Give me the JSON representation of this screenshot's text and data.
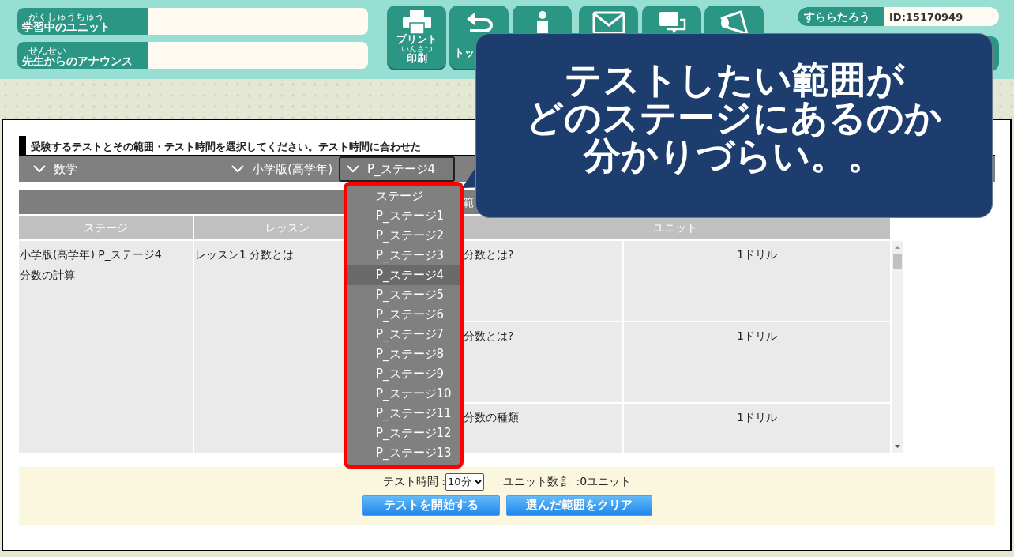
{
  "header": {
    "fields": [
      {
        "ruby_base": "学習中",
        "ruby": "がくしゅうちゅう",
        "rest": "のユニット"
      },
      {
        "ruby_base": "先生",
        "ruby": "せんせい",
        "rest": "からのアナウンス"
      }
    ],
    "toolbar": [
      {
        "kind": "print",
        "label": "プリント",
        "ruby_base": "印刷",
        "ruby": "いんさつ"
      },
      {
        "kind": "back",
        "label": "トッ"
      },
      {
        "kind": "person"
      },
      {
        "kind": "mail"
      },
      {
        "kind": "help"
      },
      {
        "kind": "megaphone"
      }
    ],
    "user": {
      "name": "すららたろう",
      "id": "ID:15170949"
    }
  },
  "instruction": "受験するテストとその範囲・テスト時間を選択してください。テスト時間に合わせた",
  "selects": [
    {
      "value": "数学",
      "focused": false
    },
    {
      "value": "小学版(高学年)",
      "focused": false
    },
    {
      "value": "P_ステージ4",
      "focused": true
    }
  ],
  "table": {
    "range_header": "範",
    "columns": [
      "ステージ",
      "レッスン",
      "ユニット"
    ],
    "stage": [
      "小学版(高学年) P_ステージ4",
      "分数の計算"
    ],
    "lesson": "レッスン1 分数とは",
    "units": [
      {
        "name": "分数とは?",
        "drills": "1ドリル"
      },
      {
        "name": "分数とは?",
        "drills": "1ドリル"
      },
      {
        "name": "分数の種類",
        "drills": "1ドリル"
      }
    ]
  },
  "dropdown": {
    "options": [
      {
        "label": "ステージ",
        "selected": false
      },
      {
        "label": "P_ステージ1",
        "selected": false
      },
      {
        "label": "P_ステージ2",
        "selected": false
      },
      {
        "label": "P_ステージ3",
        "selected": false
      },
      {
        "label": "P_ステージ4",
        "selected": true
      },
      {
        "label": "P_ステージ5",
        "selected": false
      },
      {
        "label": "P_ステージ6",
        "selected": false
      },
      {
        "label": "P_ステージ7",
        "selected": false
      },
      {
        "label": "P_ステージ8",
        "selected": false
      },
      {
        "label": "P_ステージ9",
        "selected": false
      },
      {
        "label": "P_ステージ10",
        "selected": false
      },
      {
        "label": "P_ステージ11",
        "selected": false
      },
      {
        "label": "P_ステージ12",
        "selected": false
      },
      {
        "label": "P_ステージ13",
        "selected": false
      }
    ]
  },
  "footer": {
    "time_label": "テスト時間 :",
    "time_value": "10分",
    "unit_count": "ユニット数 計 :0ユニット",
    "buttons": [
      "テストを開始する",
      "選んだ範囲をクリア"
    ]
  },
  "callout": {
    "lines": [
      "テストしたい範囲が",
      "どのステージにあるのか",
      "分かりづらい。。"
    ]
  }
}
